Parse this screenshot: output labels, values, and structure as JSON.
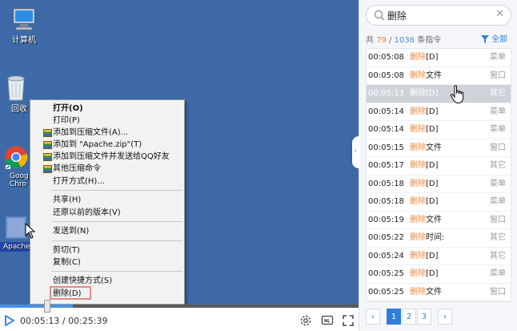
{
  "desktop": {
    "icons": [
      {
        "label": "计算机"
      },
      {
        "label": "回收"
      },
      {
        "label": "Goog\nChro"
      },
      {
        "label": "Apache"
      }
    ]
  },
  "context_menu": {
    "items": [
      {
        "label": "打开(O)",
        "bold": true
      },
      {
        "label": "打印(P)"
      },
      {
        "label": "添加到压缩文件(A)..."
      },
      {
        "label": "添加到 \"Apache.zip\"(T)"
      },
      {
        "label": "添加到压缩文件并发送给QQ好友"
      },
      {
        "label": "其他压缩命令"
      },
      {
        "label": "打开方式(H)..."
      },
      {
        "label": "共享(H)"
      },
      {
        "label": "还原以前的版本(V)"
      },
      {
        "label": "发送到(N)"
      },
      {
        "label": "剪切(T)"
      },
      {
        "label": "复制(C)"
      },
      {
        "label": "创建快捷方式(S)"
      },
      {
        "label": "删除(D)"
      }
    ]
  },
  "player": {
    "current_time": "00:05:13",
    "separator": " / ",
    "total_time": "00:25:39",
    "progress_fraction": 0.204,
    "icons": [
      "play-icon",
      "settings-icon",
      "quality-icon",
      "fullscreen-icon"
    ]
  },
  "panel": {
    "search": {
      "value": "删除",
      "placeholder": ""
    },
    "summary": {
      "prefix": "共",
      "current": "79",
      "sep": " / ",
      "total": "1036",
      "suffix": " 条指令"
    },
    "filter_label": "全部",
    "rows": [
      {
        "time": "00:05:08",
        "hl": "删除",
        "rest": "[D]",
        "category": "菜单",
        "active": false
      },
      {
        "time": "00:05:08",
        "hl": "删除",
        "rest": "文件",
        "category": "窗口",
        "active": false
      },
      {
        "time": "00:05:13",
        "hl": "删除",
        "rest": "[D]",
        "category": "其它",
        "active": true
      },
      {
        "time": "00:05:14",
        "hl": "删除",
        "rest": "[D]",
        "category": "菜单",
        "active": false
      },
      {
        "time": "00:05:14",
        "hl": "删除",
        "rest": "[D]",
        "category": "菜单",
        "active": false
      },
      {
        "time": "00:05:15",
        "hl": "删除",
        "rest": "文件",
        "category": "窗口",
        "active": false
      },
      {
        "time": "00:05:17",
        "hl": "删除",
        "rest": "[D]",
        "category": "其它",
        "active": false
      },
      {
        "time": "00:05:18",
        "hl": "删除",
        "rest": "[D]",
        "category": "菜单",
        "active": false
      },
      {
        "time": "00:05:18",
        "hl": "删除",
        "rest": "[D]",
        "category": "菜单",
        "active": false
      },
      {
        "time": "00:05:19",
        "hl": "删除",
        "rest": "文件",
        "category": "窗口",
        "active": false
      },
      {
        "time": "00:05:22",
        "hl": "删除",
        "rest": "时间:",
        "category": "其它",
        "active": false
      },
      {
        "time": "00:05:24",
        "hl": "删除",
        "rest": "[D]",
        "category": "其它",
        "active": false
      },
      {
        "time": "00:05:25",
        "hl": "删除",
        "rest": "[D]",
        "category": "菜单",
        "active": false
      },
      {
        "time": "00:05:25",
        "hl": "删除",
        "rest": "文件",
        "category": "窗口",
        "active": false
      }
    ],
    "pagination": {
      "prev": "‹",
      "pages": [
        "1",
        "2",
        "3"
      ],
      "next": "›",
      "current": "1"
    }
  },
  "colors": {
    "accent": "#2f7fd8",
    "highlight": "#f0873a",
    "desktop": "#3d6aa6"
  }
}
